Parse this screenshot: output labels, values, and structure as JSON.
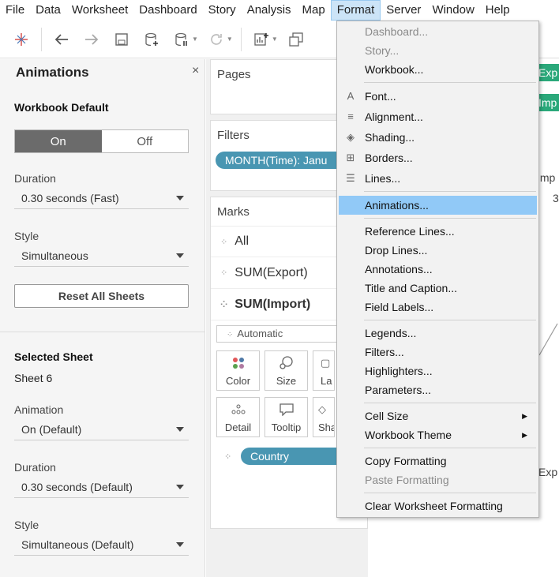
{
  "menubar": [
    "File",
    "Data",
    "Worksheet",
    "Dashboard",
    "Story",
    "Analysis",
    "Map",
    "Format",
    "Server",
    "Window",
    "Help"
  ],
  "animations": {
    "title": "Animations",
    "close": "×",
    "workbook_default": "Workbook Default",
    "on": "On",
    "off": "Off",
    "duration_label": "Duration",
    "duration_value": "0.30 seconds (Fast)",
    "style_label": "Style",
    "style_value": "Simultaneous",
    "reset": "Reset All Sheets",
    "selected_sheet": "Selected Sheet",
    "sheet_name": "Sheet 6",
    "animation_label": "Animation",
    "animation_value": "On (Default)",
    "duration2_label": "Duration",
    "duration2_value": "0.30 seconds (Default)",
    "style2_label": "Style",
    "style2_value": "Simultaneous (Default)"
  },
  "cards": {
    "pages": "Pages",
    "filters": "Filters",
    "filter_pill": "MONTH(Time): Janu",
    "marks": "Marks",
    "marks_all": "All",
    "marks_export": "SUM(Export)",
    "marks_import": "SUM(Import)",
    "automatic": "Automatic",
    "color": "Color",
    "size": "Size",
    "label": "La",
    "detail": "Detail",
    "tooltip": "Tooltip",
    "shape": "Sha",
    "country_pill": "Country"
  },
  "right": {
    "exp_pill": "Exp",
    "imp_pill": "Imp",
    "imp_label": "Imp",
    "num_label": "3",
    "exp_label": "Exp"
  },
  "format_menu": {
    "dashboard": "Dashboard...",
    "story": "Story...",
    "workbook": "Workbook...",
    "font": "Font...",
    "alignment": "Alignment...",
    "shading": "Shading...",
    "borders": "Borders...",
    "lines": "Lines...",
    "animations": "Animations...",
    "reference_lines": "Reference Lines...",
    "drop_lines": "Drop Lines...",
    "annotations": "Annotations...",
    "title_caption": "Title and Caption...",
    "field_labels": "Field Labels...",
    "legends": "Legends...",
    "filters": "Filters...",
    "highlighters": "Highlighters...",
    "parameters": "Parameters...",
    "cell_size": "Cell Size",
    "workbook_theme": "Workbook Theme",
    "copy_formatting": "Copy Formatting",
    "paste_formatting": "Paste Formatting",
    "clear_formatting": "Clear Worksheet Formatting"
  }
}
